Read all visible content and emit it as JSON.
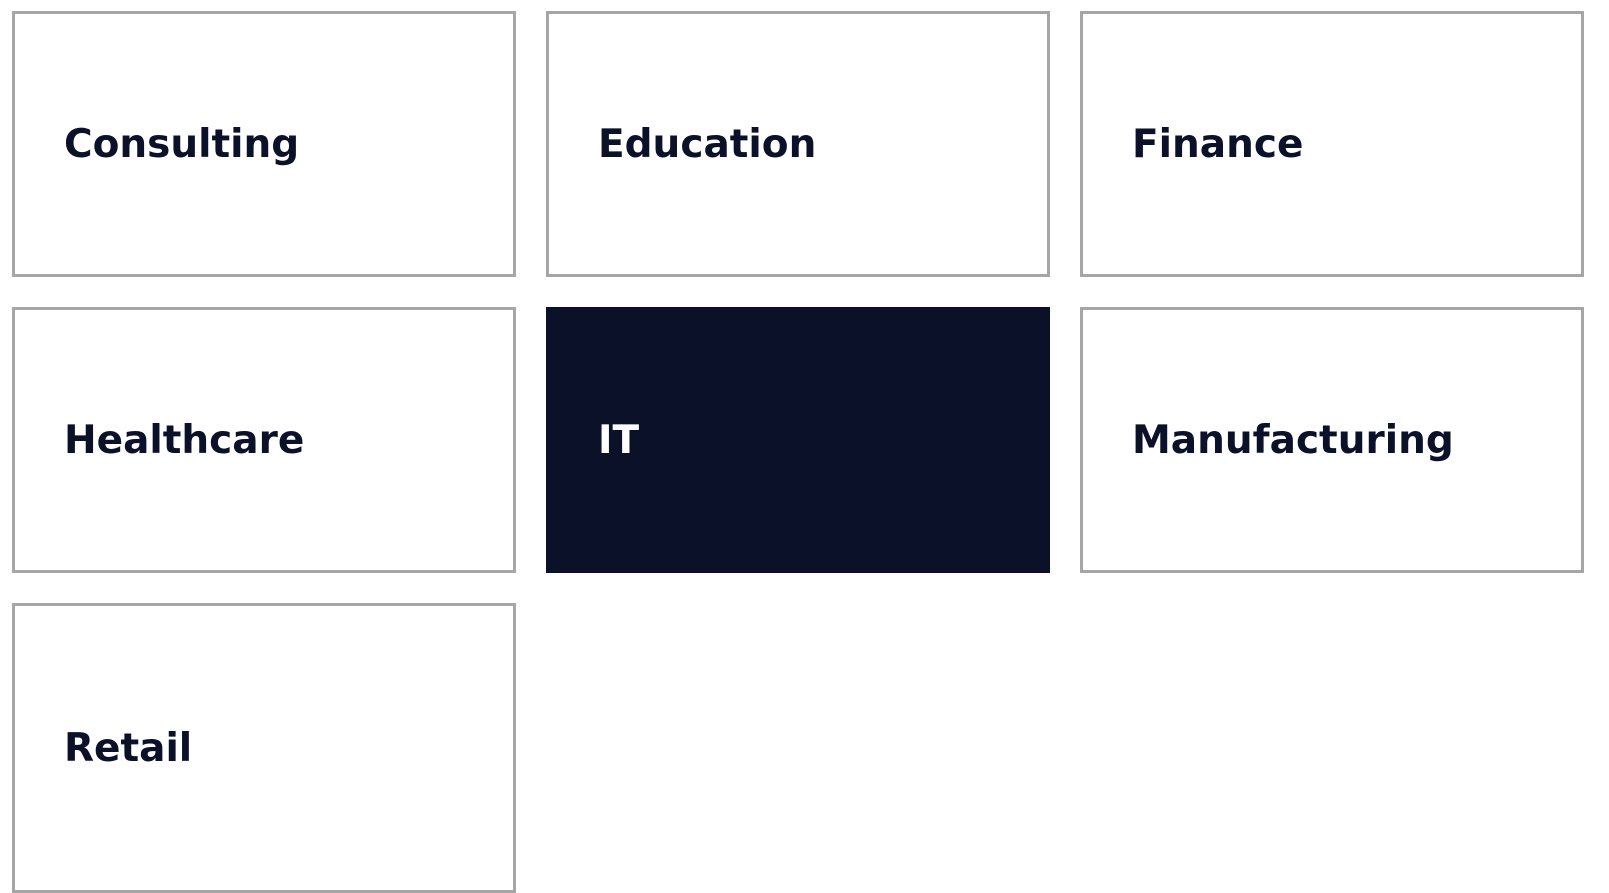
{
  "industries": {
    "selected_index": 4,
    "items": [
      {
        "label": "Consulting"
      },
      {
        "label": "Education"
      },
      {
        "label": "Finance"
      },
      {
        "label": "Healthcare"
      },
      {
        "label": "IT"
      },
      {
        "label": "Manufacturing"
      },
      {
        "label": "Retail"
      }
    ]
  },
  "colors": {
    "selected_background": "#0a1128",
    "text": "#0a1128",
    "tile_border": "#a6a6a6",
    "selected_text": "#ffffff"
  }
}
